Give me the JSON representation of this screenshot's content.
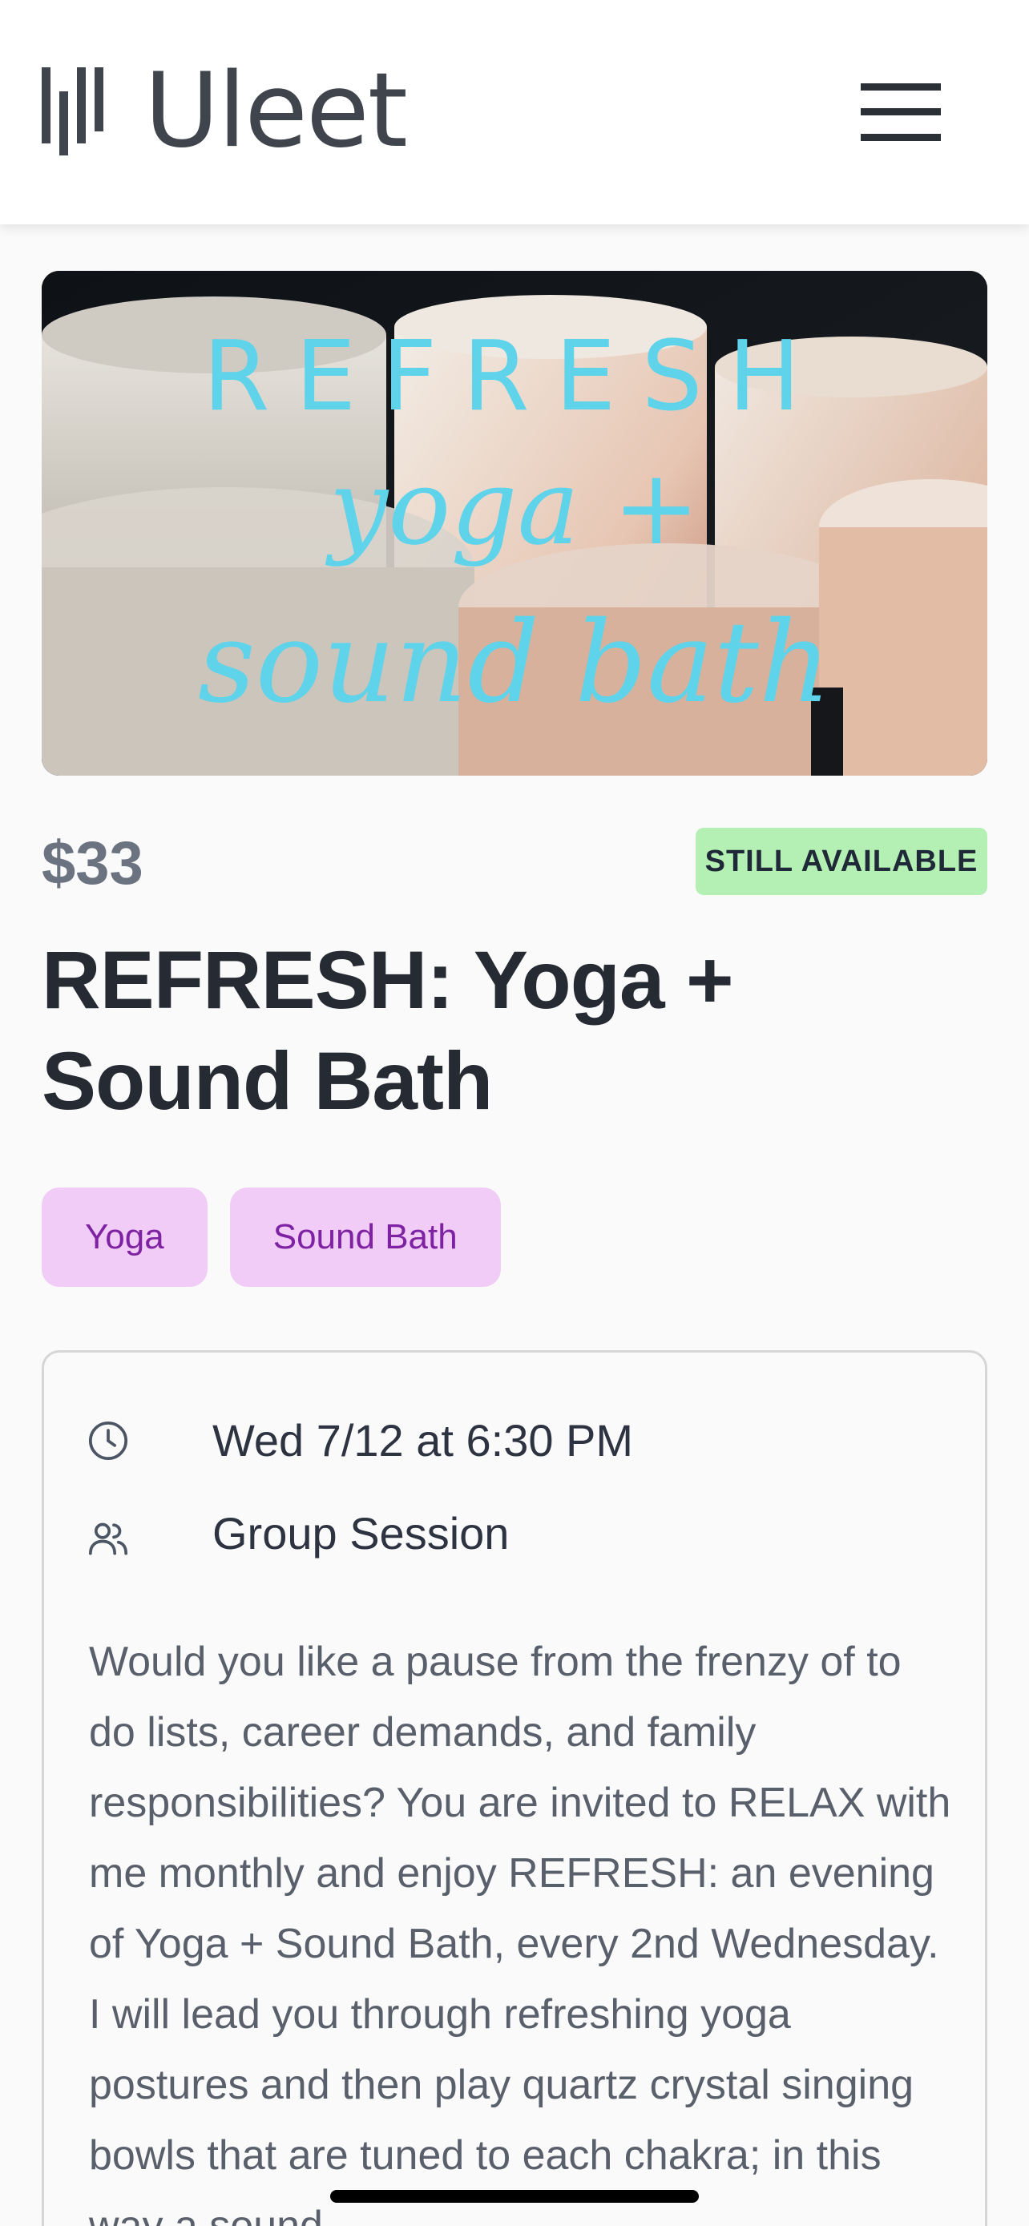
{
  "header": {
    "brand": "Uleet",
    "menu_icon": "hamburger-menu-icon"
  },
  "hero": {
    "line1": "REFRESH",
    "line2": "yoga +",
    "line3": "sound bath",
    "text_color": "#5fd3ea"
  },
  "event": {
    "price": "$33",
    "availability": "STILL AVAILABLE",
    "title": "REFRESH: Yoga + Sound Bath",
    "tags": [
      "Yoga",
      "Sound Bath"
    ],
    "datetime": "Wed 7/12 at 6:30 PM",
    "session_type": "Group Session",
    "description": "Would you like a pause from the frenzy of to do lists, career demands, and family responsibilities? You are invited to RELAX with me monthly and enjoy REFRESH: an evening of Yoga + Sound Bath, every 2nd Wednesday. I will lead you through refreshing yoga postures and then play quartz crystal singing bowls that are tuned to each chakra; in this way a sound"
  },
  "colors": {
    "badge_bg": "#b4f0b4",
    "tag_bg": "#f0ccf6",
    "tag_text": "#7e22a3"
  }
}
